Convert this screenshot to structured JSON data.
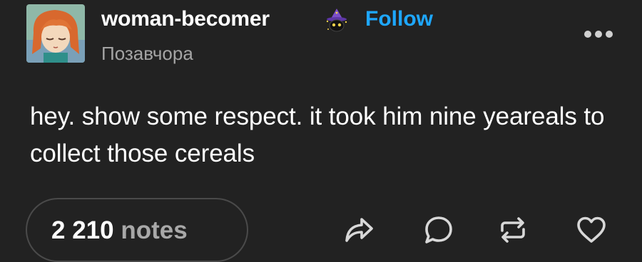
{
  "header": {
    "blog_name": "woman-becomer",
    "follow_label": "Follow",
    "timestamp": "Позавчора",
    "avatar_icon": "anime-avatar-icon",
    "badge_icon": "witch-cat-badge-icon",
    "more_icon": "more-dots-icon"
  },
  "post": {
    "text": "hey. show some respect. it took him nine yeareals to collect those cereals"
  },
  "footer": {
    "notes_count": "2 210",
    "notes_word": "notes",
    "actions": [
      "share-icon",
      "reply-icon",
      "reblog-icon",
      "like-icon"
    ]
  },
  "colors": {
    "background": "#222222",
    "text": "#ffffff",
    "muted": "#a4a4a4",
    "accent": "#1ea7ff",
    "pill_border": "#4a4a4a"
  }
}
